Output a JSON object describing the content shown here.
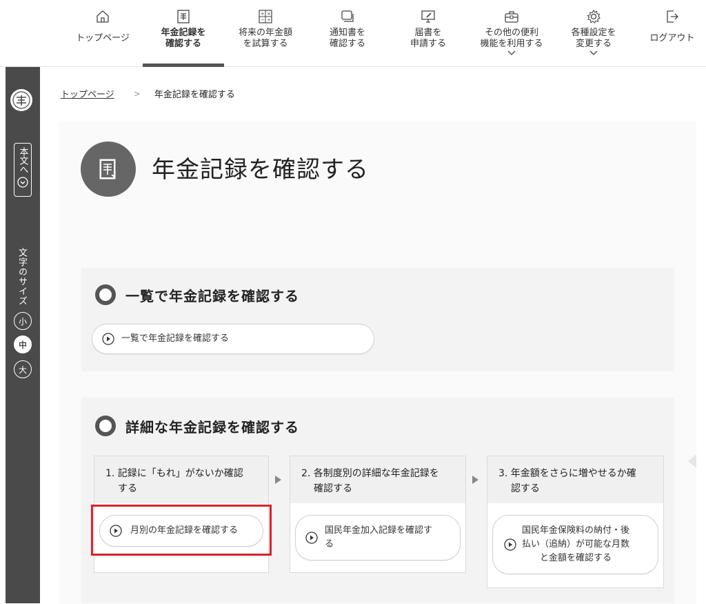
{
  "nav": {
    "items": [
      {
        "label": "トップページ",
        "icon": "home-icon"
      },
      {
        "label": "年金記録を\n確認する",
        "icon": "document-icon",
        "active": true
      },
      {
        "label": "将来の年金額\nを試算する",
        "icon": "calculator-icon"
      },
      {
        "label": "通知書を\n確認する",
        "icon": "mail-stack-icon"
      },
      {
        "label": "届書を\n申請する",
        "icon": "monitor-edit-icon"
      },
      {
        "label": "その他の便利\n機能を利用する",
        "icon": "toolbox-icon"
      },
      {
        "label": "各種設定を\n変更する",
        "icon": "gear-icon"
      },
      {
        "label": "ログアウト",
        "icon": "logout-icon"
      }
    ]
  },
  "sidebar": {
    "skip_label": "本文へ",
    "font_size_label": "文字のサイズ",
    "sizes": [
      "小",
      "中",
      "大"
    ],
    "selected_size": "中"
  },
  "breadcrumb": {
    "home": "トップページ",
    "separator": ">",
    "current": "年金記録を確認する"
  },
  "page": {
    "title": "年金記録を確認する"
  },
  "section1": {
    "title": "一覧で年金記録を確認する",
    "link": "一覧で年金記録を確認する"
  },
  "section2": {
    "title": "詳細な年金記録を確認する",
    "steps": [
      {
        "head_line1": "1. 記録に「もれ」がないか確認",
        "head_line2": "する",
        "link": "月別の年金記録を確認する"
      },
      {
        "head_line1": "2. 各制度別の詳細な年金記録を",
        "head_line2": "確認する",
        "link_line1": "国民年金加入記録を確認す",
        "link_line2": "る"
      },
      {
        "head_line1": "3. 年金額をさらに増やせるか確",
        "head_line2": "認する",
        "link_line1": "国民年金保険料の納付・後",
        "link_line2": "払い（追納）が可能な月数",
        "link_line3": "と金額を確認する"
      }
    ]
  },
  "colors": {
    "accent_dark": "#555555",
    "sidebar_bg": "#4a4a4a",
    "highlight_red": "#d8232a"
  }
}
